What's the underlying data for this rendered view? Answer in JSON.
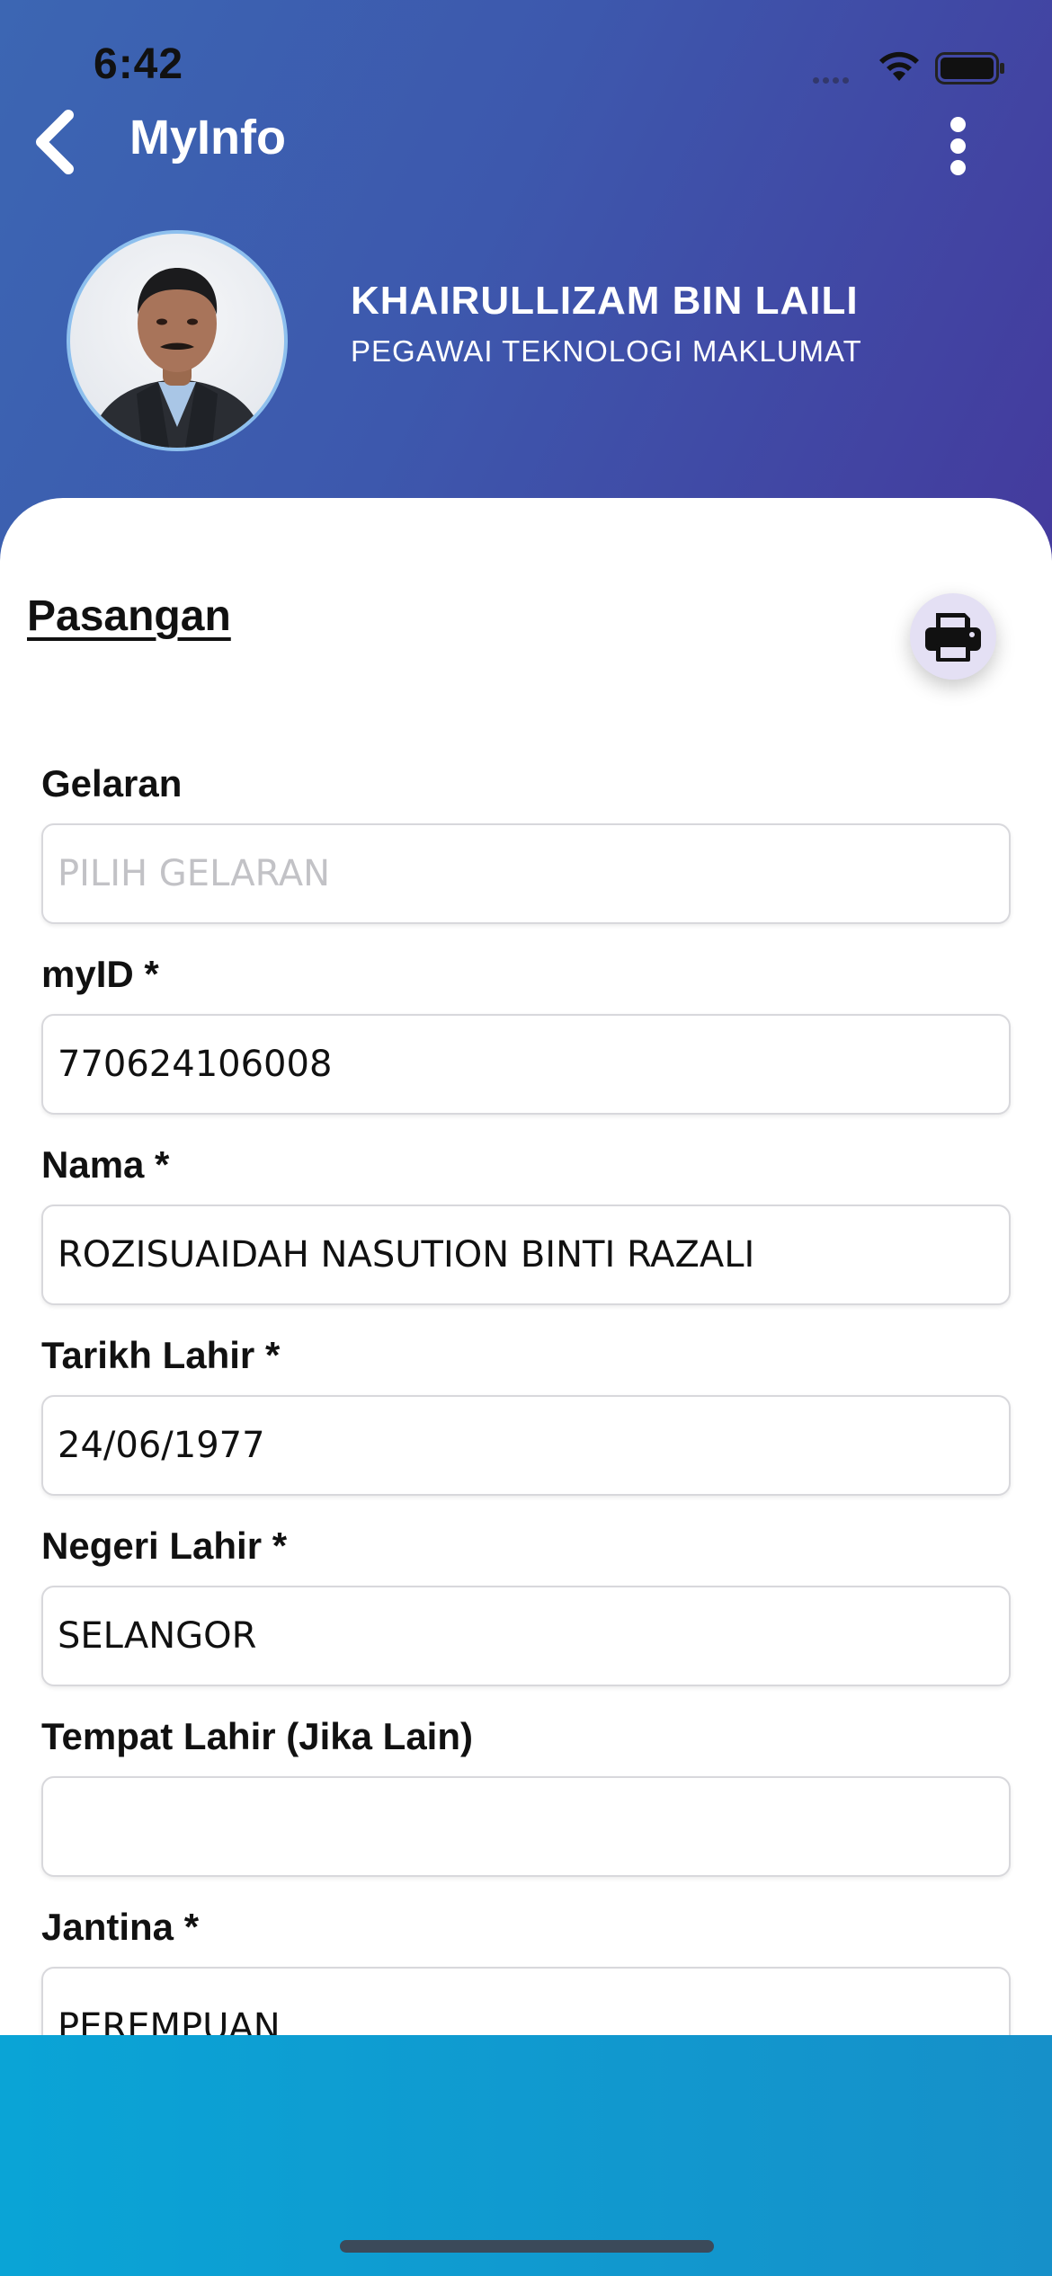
{
  "status_bar": {
    "time": "6:42"
  },
  "nav": {
    "title": "MyInfo"
  },
  "profile": {
    "name": "KHAIRULLIZAM BIN LAILI",
    "role": "PEGAWAI TEKNOLOGI MAKLUMAT"
  },
  "section": {
    "title": "Pasangan"
  },
  "fields": [
    {
      "label": "Gelaran",
      "value": "",
      "placeholder": "PILIH GELARAN"
    },
    {
      "label": "myID *",
      "value": "770624106008",
      "placeholder": ""
    },
    {
      "label": "Nama *",
      "value": "ROZISUAIDAH NASUTION BINTI RAZALI",
      "placeholder": ""
    },
    {
      "label": "Tarikh Lahir *",
      "value": "24/06/1977",
      "placeholder": ""
    },
    {
      "label": "Negeri Lahir *",
      "value": "SELANGOR",
      "placeholder": ""
    },
    {
      "label": "Tempat Lahir (Jika Lain)",
      "value": "",
      "placeholder": ""
    },
    {
      "label": "Jantina *",
      "value": "PEREMPUAN",
      "placeholder": ""
    }
  ],
  "colors": {
    "header_gradient_start": "#3c66b3",
    "header_gradient_end": "#443a9d",
    "bottom_bar": "#1690c9",
    "print_button_bg": "#e4e0f4"
  },
  "icons": {
    "back": "chevron-left-icon",
    "more": "vertical-dots-icon",
    "print": "printer-icon"
  }
}
